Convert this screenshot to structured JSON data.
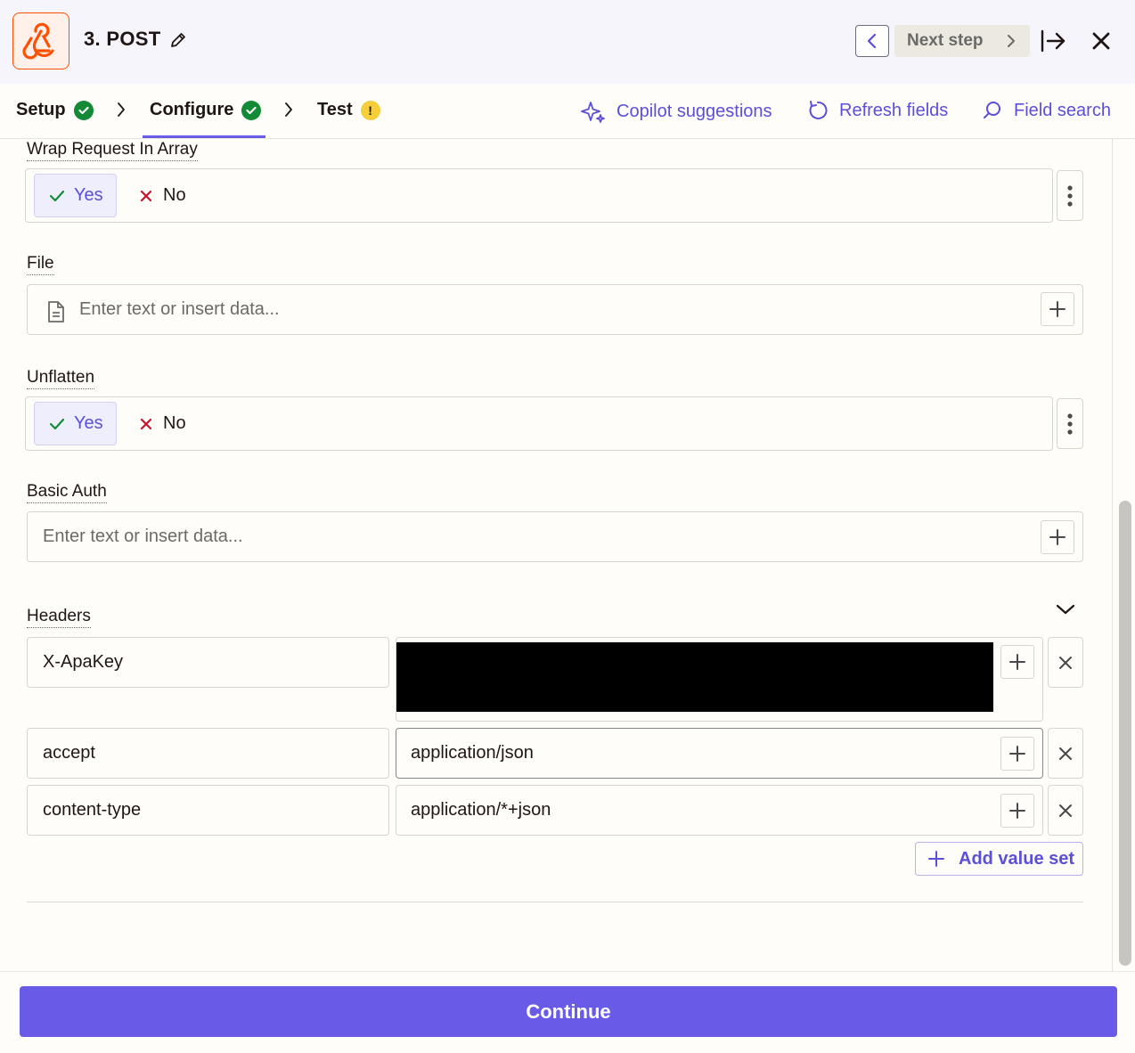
{
  "header": {
    "step_title": "3. POST",
    "next_step_label": "Next step",
    "app_icon": "webhook-icon"
  },
  "tabs": [
    {
      "label": "Setup",
      "status": "complete"
    },
    {
      "label": "Configure",
      "status": "complete",
      "active": true
    },
    {
      "label": "Test",
      "status": "warning",
      "badge": "!"
    }
  ],
  "actions": {
    "copilot": "Copilot suggestions",
    "refresh": "Refresh fields",
    "search": "Field search"
  },
  "fields": {
    "wrap_request": {
      "label": "Wrap Request In Array",
      "yes": "Yes",
      "no": "No",
      "selected": "Yes"
    },
    "file": {
      "label": "File",
      "placeholder": "Enter text or insert data..."
    },
    "unflatten": {
      "label": "Unflatten",
      "yes": "Yes",
      "no": "No",
      "selected": "Yes"
    },
    "basic_auth": {
      "label": "Basic Auth",
      "placeholder": "Enter text or insert data..."
    },
    "headers": {
      "label": "Headers",
      "rows": [
        {
          "key": "X-ApaKey",
          "value": "",
          "redacted": true
        },
        {
          "key": "accept",
          "value": "application/json"
        },
        {
          "key": "content-type",
          "value": "application/*+json"
        }
      ],
      "add_label": "Add value set"
    }
  },
  "footer": {
    "continue_label": "Continue"
  },
  "colors": {
    "accent": "#695be8",
    "brand_orange": "#ff4f00",
    "success": "#138a36",
    "warning": "#f6cd3b"
  }
}
